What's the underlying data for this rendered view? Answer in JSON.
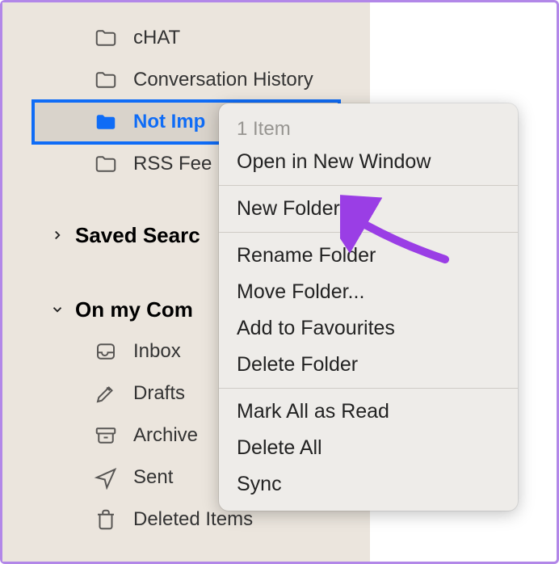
{
  "folders": [
    {
      "label": "cHAT",
      "icon": "folder-outline",
      "selected": false
    },
    {
      "label": "Conversation History",
      "icon": "folder-outline",
      "selected": false
    },
    {
      "label": "Not Imp",
      "icon": "folder-solid",
      "selected": true
    },
    {
      "label": "RSS Fee",
      "icon": "folder-outline",
      "selected": false
    }
  ],
  "sections": [
    {
      "title": "Saved Searc",
      "expanded": false
    },
    {
      "title": "On my Com",
      "expanded": true
    }
  ],
  "on_my_computer": [
    {
      "label": "Inbox",
      "icon": "inbox"
    },
    {
      "label": "Drafts",
      "icon": "drafts"
    },
    {
      "label": "Archive",
      "icon": "archive"
    },
    {
      "label": "Sent",
      "icon": "sent"
    },
    {
      "label": "Deleted Items",
      "icon": "trash"
    }
  ],
  "context_menu": {
    "header": "1 Item",
    "groups": [
      [
        "Open in New Window"
      ],
      [
        "New Folder"
      ],
      [
        "Rename Folder",
        "Move Folder...",
        "Add to Favourites",
        "Delete Folder"
      ],
      [
        "Mark All as Read",
        "Delete All",
        "Sync"
      ]
    ]
  },
  "annotation_color": "#9a3ee5"
}
